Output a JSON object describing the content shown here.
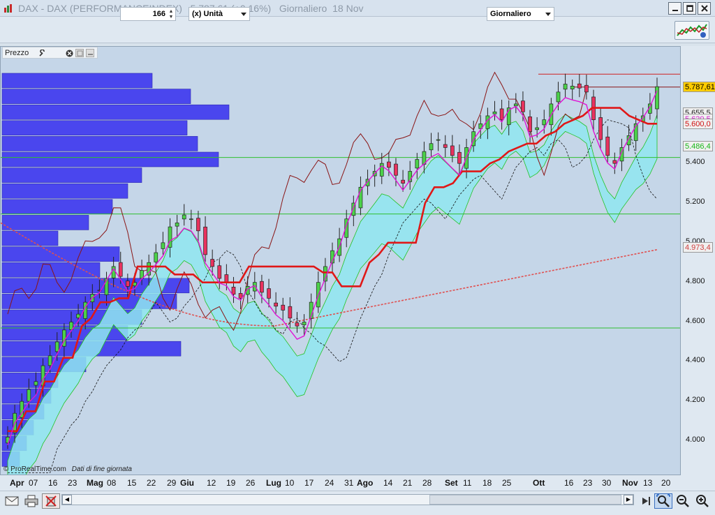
{
  "window": {
    "title": "DAX - DAX (PERFORMANCEINDEX)",
    "last_price": "5.787,61",
    "change": "(+0,16%)",
    "period": "Giornaliero",
    "date": "18 Nov",
    "minimize_label": "_",
    "restore_label": "❐",
    "close_label": "✕"
  },
  "toolbar": {
    "units_count": "166",
    "units_select": "(x) Unità",
    "timeframe_select": "Giornaliero"
  },
  "chart_header": {
    "label": "Prezzo"
  },
  "colors": {
    "chart_bg": "#c5d6e8",
    "volume_profile": "#4a46ee",
    "candle_up": "#4cd24a",
    "candle_down": "#e8325e",
    "kijun": "#e01717",
    "tenkan": "#e014d4",
    "chikou": "#8a1414",
    "cloud_bull": "#8fe6f0",
    "cloud_bear": "#8edc9c",
    "mm_long": "#e05050"
  },
  "price_axis": {
    "ticks": [
      "4.000",
      "4.200",
      "4.400",
      "4.600",
      "4.800",
      "5.000",
      "5.200",
      "5.400"
    ],
    "labels": [
      {
        "text": "5.787,61",
        "bg": "#ffcc00",
        "fg": "#000000"
      },
      {
        "text": "5.655,5",
        "bg": "#f0f0f0",
        "fg": "#222222"
      },
      {
        "text": "5.620,5",
        "bg": "#f0f0f0",
        "fg": "#d61ecf"
      },
      {
        "text": "5.600,0",
        "bg": "#f0f0f0",
        "fg": "#d01010"
      },
      {
        "text": "5.486,4",
        "bg": "#f0f0f0",
        "fg": "#18b818"
      },
      {
        "text": "4.973,4",
        "bg": "#f0f0f0",
        "fg": "#d04040"
      }
    ]
  },
  "date_axis": {
    "ticks": [
      {
        "text": "Apr",
        "bold": true
      },
      {
        "text": "07",
        "bold": false
      },
      {
        "text": "16",
        "bold": false
      },
      {
        "text": "23",
        "bold": false
      },
      {
        "text": "Mag",
        "bold": true
      },
      {
        "text": "08",
        "bold": false
      },
      {
        "text": "15",
        "bold": false
      },
      {
        "text": "22",
        "bold": false
      },
      {
        "text": "29",
        "bold": false
      },
      {
        "text": "Giu",
        "bold": true
      },
      {
        "text": "12",
        "bold": false
      },
      {
        "text": "19",
        "bold": false
      },
      {
        "text": "26",
        "bold": false
      },
      {
        "text": "Lug",
        "bold": true
      },
      {
        "text": "10",
        "bold": false
      },
      {
        "text": "17",
        "bold": false
      },
      {
        "text": "24",
        "bold": false
      },
      {
        "text": "31",
        "bold": false
      },
      {
        "text": "Ago",
        "bold": true
      },
      {
        "text": "14",
        "bold": false
      },
      {
        "text": "21",
        "bold": false
      },
      {
        "text": "28",
        "bold": false
      },
      {
        "text": "Set",
        "bold": true
      },
      {
        "text": "11",
        "bold": false
      },
      {
        "text": "18",
        "bold": false
      },
      {
        "text": "25",
        "bold": false
      },
      {
        "text": "Ott",
        "bold": true
      },
      {
        "text": "16",
        "bold": false
      },
      {
        "text": "23",
        "bold": false
      },
      {
        "text": "30",
        "bold": false
      },
      {
        "text": "Nov",
        "bold": true
      },
      {
        "text": "13",
        "bold": false
      },
      {
        "text": "20",
        "bold": false
      }
    ]
  },
  "footer": {
    "copyright": "© ProRealTime.com",
    "note": "Dati di fine giornata"
  },
  "statusbar": {
    "buttons": [
      "mail-icon",
      "print-icon",
      "delete-icon",
      "scroll-left-icon",
      "scroll-right-icon",
      "fit-icon",
      "zoom-out-icon",
      "zoom-in-icon"
    ]
  },
  "chart_data": {
    "type": "candlestick",
    "title": "DAX - DAX (PERFORMANCEINDEX)",
    "ylim": [
      3900,
      5900
    ],
    "horizontal_levels": [
      5430,
      5145,
      4570,
      5850,
      5785
    ],
    "x_categories": [
      "Apr",
      "07",
      "16",
      "23",
      "Mag",
      "08",
      "15",
      "22",
      "29",
      "Giu",
      "12",
      "19",
      "26",
      "Lug",
      "10",
      "17",
      "24",
      "31",
      "Ago",
      "14",
      "21",
      "28",
      "Set",
      "11",
      "18",
      "25",
      "Ott",
      "16",
      "23",
      "30",
      "Nov",
      "13",
      "20"
    ],
    "close_series": [
      4020,
      4140,
      4200,
      4260,
      4300,
      4380,
      4430,
      4500,
      4560,
      4600,
      4640,
      4700,
      4740,
      4760,
      4820,
      4880,
      4830,
      4780,
      4800,
      4860,
      4900,
      4950,
      5000,
      5080,
      5100,
      5140,
      5120,
      5060,
      4940,
      4880,
      4820,
      4800,
      4740,
      4720,
      4780,
      4800,
      4750,
      4720,
      4680,
      4660,
      4620,
      4580,
      4600,
      4700,
      4800,
      4880,
      4960,
      5020,
      5120,
      5200,
      5280,
      5320,
      5360,
      5400,
      5380,
      5340,
      5300,
      5360,
      5420,
      5460,
      5500,
      5520,
      5480,
      5440,
      5400,
      5480,
      5560,
      5600,
      5640,
      5660,
      5620,
      5680,
      5700,
      5660,
      5560,
      5580,
      5620,
      5700,
      5760,
      5800,
      5790,
      5780,
      5760,
      5620,
      5520,
      5440,
      5400,
      5480,
      5540,
      5600,
      5640,
      5700,
      5787
    ],
    "kijun": [
      4050,
      4050,
      4150,
      4150,
      4300,
      4300,
      4420,
      4420,
      4580,
      4620,
      4700,
      4700,
      4720,
      4720,
      4880,
      4880,
      4880,
      4880,
      4840,
      4840,
      4840,
      4800,
      4800,
      4800,
      4800,
      4800,
      4880,
      4880,
      4880,
      4880,
      4880,
      4880,
      4880,
      4880,
      4850,
      4850,
      4780,
      4780,
      4780,
      4900,
      4940,
      5000,
      5000,
      5000,
      5000,
      5200,
      5280,
      5280,
      5300,
      5360,
      5360,
      5360,
      5400,
      5420,
      5460,
      5480,
      5500,
      5500,
      5540,
      5560,
      5600,
      5620,
      5640,
      5680,
      5680,
      5680,
      5680,
      5640,
      5620,
      5600,
      5600
    ]
  }
}
